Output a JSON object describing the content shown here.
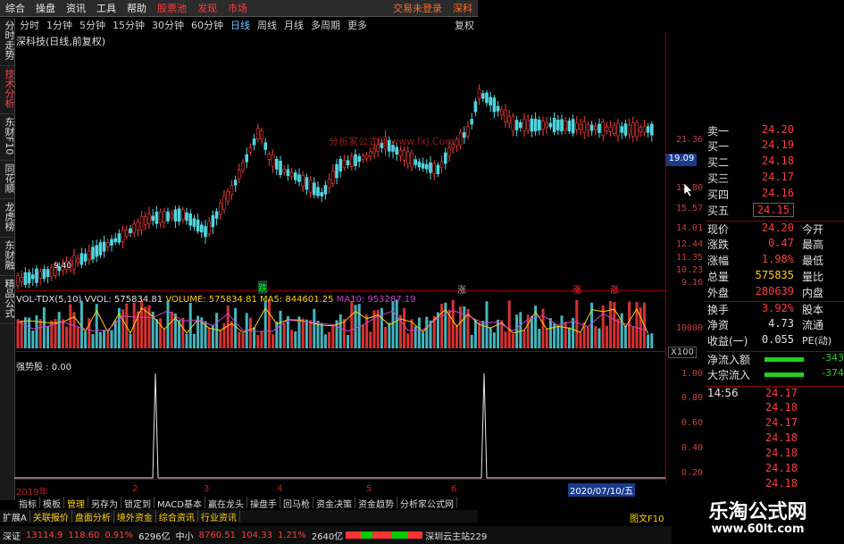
{
  "menu": {
    "items": [
      "综合",
      "操盘",
      "资讯",
      "工具",
      "帮助"
    ],
    "red_items": [
      "股票池",
      "发现",
      "市场"
    ],
    "right_status": "交易未登录",
    "right_item": "深科"
  },
  "periods": [
    "分时",
    "1分钟",
    "5分钟",
    "15分钟",
    "30分钟",
    "60分钟",
    "日线",
    "周线",
    "月线",
    "多周期",
    "更多"
  ],
  "active_period": "日线",
  "left_nav": [
    "分时走势",
    "技术分析",
    "东财F10",
    "同花顺",
    "龙虎榜",
    "东财融",
    "精品公式"
  ],
  "stock_title": "深科技(日线,前复权)",
  "top_right_label": "复权",
  "price_axis": [
    "21.36",
    "19.09",
    "17.80",
    "15.57",
    "14.01",
    "12.44",
    "11.35",
    "10.23",
    "9.16"
  ],
  "current_price_badge": "19.09",
  "low_label": "9.40",
  "watermark": "分析家公式网 www.fxj.Com",
  "markers": {
    "m1": "跌",
    "m2": "涨",
    "m3": "涨",
    "m4": "涨"
  },
  "vol_legend": {
    "name": "VOL-TDX(5,10)",
    "vvol": "VVOL: 575834.81",
    "volume": "VOLUME: 575834.81",
    "ma5": "MA5: 844601.25",
    "ma10": "MA10: 953287.19"
  },
  "vol_axis": {
    "top": "10000",
    "unit": "X100"
  },
  "strong_legend": "强势股 : 0.00",
  "strong_axis": [
    "1.00",
    "0.80",
    "0.60",
    "0.40",
    "0.20"
  ],
  "date_axis": {
    "year": "2019年",
    "ticks": [
      "2",
      "3",
      "4",
      "5",
      "6"
    ],
    "cursor_date": "2020/07/10/五"
  },
  "quotes": {
    "sells": [
      {
        "label": "卖一",
        "price": "24.20",
        "vol": ""
      },
      {
        "label": "买一",
        "price": "24.19",
        "vol": ""
      },
      {
        "label": "买二",
        "price": "24.18",
        "vol": ""
      },
      {
        "label": "买三",
        "price": "24.17",
        "vol": ""
      },
      {
        "label": "买四",
        "price": "24.16",
        "vol": ""
      },
      {
        "label": "买五",
        "price": "24.15",
        "vol": ""
      }
    ],
    "stats": [
      {
        "label": "现价",
        "value": "24.20",
        "extra": "今开"
      },
      {
        "label": "涨跌",
        "value": "0.47",
        "extra": "最高"
      },
      {
        "label": "涨幅",
        "value": "1.98%",
        "extra": "最低"
      },
      {
        "label": "总量",
        "value": "575835",
        "extra": "量比"
      },
      {
        "label": "外盘",
        "value": "280639",
        "extra": "内盘"
      }
    ],
    "stats2": [
      {
        "label": "换手",
        "value": "3.92%",
        "extra": "股本"
      },
      {
        "label": "净资",
        "value": "4.73",
        "extra": "流通"
      },
      {
        "label": "收益(一)",
        "value": "0.055",
        "extra": "PE(动)"
      }
    ],
    "flows": [
      {
        "label": "净流入额",
        "value": "-343"
      },
      {
        "label": "大宗流入",
        "value": "-374"
      }
    ],
    "ticks": [
      {
        "time": "14:56",
        "price": "24.17"
      },
      {
        "time": "",
        "price": "24.18"
      },
      {
        "time": "",
        "price": "24.17"
      },
      {
        "time": "",
        "price": "24.18"
      },
      {
        "time": "",
        "price": "24.18"
      },
      {
        "time": "",
        "price": "24.18"
      },
      {
        "time": "",
        "price": "24.18"
      },
      {
        "time": "14:57",
        "price": "24.18"
      },
      {
        "time": "",
        "price": "24.18"
      }
    ]
  },
  "bottom_tabs": [
    "指标",
    "模板",
    "管理",
    "另存为",
    "锁定到",
    "MACD基本",
    "赢在龙头",
    "操盘手",
    "回马枪",
    "资金决策",
    "资金趋势",
    "分析家公式网"
  ],
  "bottom_tabs_active": "管理",
  "bottom_tabs2": [
    "扩展A",
    "关联报价",
    "盘面分析",
    "境外资金",
    "综合资讯",
    "行业资讯"
  ],
  "f10_label": "图文F10",
  "statusbar": {
    "sh_label": "深证",
    "sh_index": "13114.9",
    "sh_change": "118.60",
    "sh_pct": "0.91%",
    "sh_amount": "6296亿",
    "zx_label": "中小",
    "zx_index": "8760.51",
    "zx_change": "104.33",
    "zx_pct": "1.21%",
    "zx_amount": "2640亿",
    "tail": "深圳云主站229"
  },
  "brand": {
    "title": "乐淘公式网",
    "url": "www.60lt.com"
  }
}
